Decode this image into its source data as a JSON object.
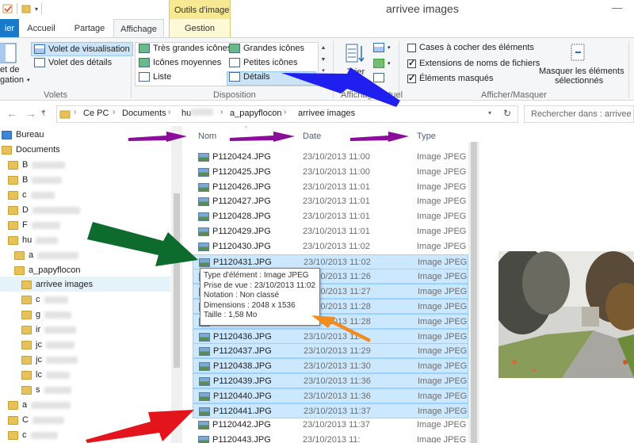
{
  "window": {
    "title": "arrivee images",
    "contextual_header": "Outils d'image"
  },
  "tabs": {
    "fichier": "ier",
    "accueil": "Accueil",
    "partage": "Partage",
    "affichage": "Affichage",
    "gestion": "Gestion"
  },
  "ribbon": {
    "volets": {
      "nav_pane_partial": "et de",
      "nav_pane_partial2": "gation",
      "visualisation": "Volet de visualisation",
      "details": "Volet des détails",
      "label": "Volets"
    },
    "disposition": {
      "tres_grandes": "Très grandes icônes",
      "grandes": "Grandes icônes",
      "moyennes": "Icônes moyennes",
      "petites": "Petites icônes",
      "liste": "Liste",
      "details": "Détails",
      "label": "Disposition"
    },
    "affichage_actuel": {
      "trier": "Trier",
      "par": "par",
      "label": "Affichage actuel"
    },
    "afficher_masquer": {
      "cases": "Cases à cocher des éléments",
      "extensions": "Extensions de noms de fichiers",
      "masques": "Éléments masqués",
      "masquer_selection_1": "Masquer les éléments",
      "masquer_selection_2": "sélectionnés",
      "label": "Afficher/Masquer",
      "cases_checked": false,
      "extensions_checked": true,
      "masques_checked": true
    }
  },
  "address": {
    "crumbs": [
      "Ce PC",
      "Documents",
      "hu",
      "a_papyflocon",
      "arrivee images"
    ],
    "search_placeholder": "Rechercher dans : arrivee im"
  },
  "nav": {
    "bureau": "Bureau",
    "documents": "Documents",
    "b1": "B",
    "b2": "B",
    "c1": "c",
    "d1": "D",
    "f1": "F",
    "hu": "hu",
    "a1": "a",
    "papyflocon": "a_papyflocon",
    "arrivee": "arrivee images",
    "s_c": "c",
    "s_g": "g",
    "s_i": "ir",
    "s_j1": "jc",
    "s_j2": "jc",
    "s_l": "lc",
    "s_s": "s",
    "a2": "a",
    "c2": "C",
    "c3": "c"
  },
  "filelist": {
    "columns": {
      "name": "Nom",
      "date": "Date",
      "type": "Type"
    },
    "rows": [
      {
        "name": "P1120424.JPG",
        "date": "23/10/2013 11:00",
        "type": "Image JPEG",
        "selected": false
      },
      {
        "name": "P1120425.JPG",
        "date": "23/10/2013 11:00",
        "type": "Image JPEG",
        "selected": false
      },
      {
        "name": "P1120426.JPG",
        "date": "23/10/2013 11:01",
        "type": "Image JPEG",
        "selected": false
      },
      {
        "name": "P1120427.JPG",
        "date": "23/10/2013 11:01",
        "type": "Image JPEG",
        "selected": false
      },
      {
        "name": "P1120428.JPG",
        "date": "23/10/2013 11:01",
        "type": "Image JPEG",
        "selected": false
      },
      {
        "name": "P1120429.JPG",
        "date": "23/10/2013 11:01",
        "type": "Image JPEG",
        "selected": false
      },
      {
        "name": "P1120430.JPG",
        "date": "23/10/2013 11:02",
        "type": "Image JPEG",
        "selected": false
      },
      {
        "name": "P1120431.JPG",
        "date": "23/10/2013 11:02",
        "type": "Image JPEG",
        "selected": true
      },
      {
        "name": "",
        "date": "23/10/2013 11:26",
        "type": "Image JPEG",
        "selected": true
      },
      {
        "name": "",
        "date": "23/10/2013 11:27",
        "type": "Image JPEG",
        "selected": true
      },
      {
        "name": "",
        "date": "23/10/2013 11:28",
        "type": "Image JPEG",
        "selected": true
      },
      {
        "name": "",
        "date": "23/10/2013 11:28",
        "type": "Image JPEG",
        "selected": true
      },
      {
        "name": "P1120436.JPG",
        "date": "23/10/2013 11:",
        "type": "Image JPEG",
        "selected": true
      },
      {
        "name": "P1120437.JPG",
        "date": "23/10/2013 11:29",
        "type": "Image JPEG",
        "selected": true
      },
      {
        "name": "P1120438.JPG",
        "date": "23/10/2013 11:30",
        "type": "Image JPEG",
        "selected": true
      },
      {
        "name": "P1120439.JPG",
        "date": "23/10/2013 11:36",
        "type": "Image JPEG",
        "selected": true
      },
      {
        "name": "P1120440.JPG",
        "date": "23/10/2013 11:36",
        "type": "Image JPEG",
        "selected": true
      },
      {
        "name": "P1120441.JPG",
        "date": "23/10/2013 11:37",
        "type": "Image JPEG",
        "selected": true
      },
      {
        "name": "P1120442.JPG",
        "date": "23/10/2013 11:37",
        "type": "Image JPEG",
        "selected": false
      },
      {
        "name": "P1120443.JPG",
        "date": "23/10/2013 11:",
        "type": "Image JPEG",
        "selected": false
      }
    ]
  },
  "tooltip": {
    "type": "Type d'élément : Image JPEG",
    "prise": "Prise de vue : 23/10/2013 11:02",
    "notation": "Notation : Non classé",
    "dimensions": "Dimensions : 2048 x 1536",
    "taille": "Taille : 1,58 Mo"
  },
  "colors": {
    "accent": "#1979ca",
    "selection": "#cce8ff",
    "contextual": "#f7e992",
    "arrow_blue": "#1f1ff0",
    "arrow_purple": "#8b0e9b",
    "arrow_green": "#0d6b2e",
    "arrow_red": "#e3141b",
    "arrow_orange": "#f28c1e"
  }
}
